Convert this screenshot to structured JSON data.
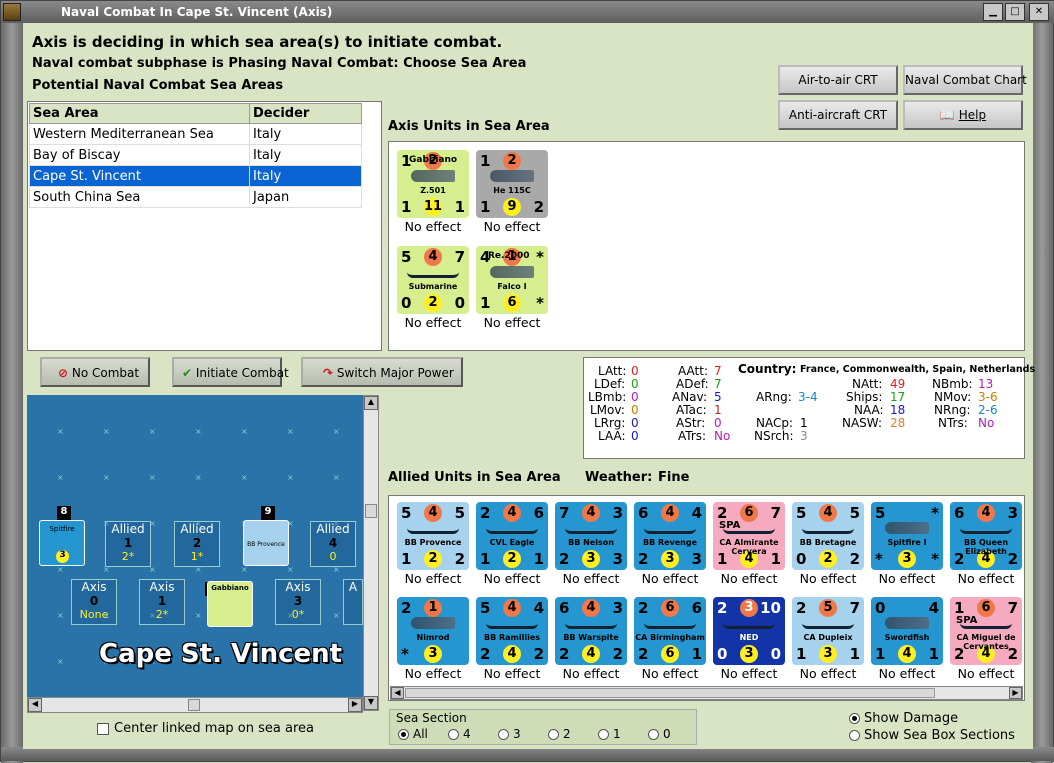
{
  "window": {
    "title": "Naval Combat In Cape St. Vincent (Axis)"
  },
  "header": {
    "line1": "Axis is deciding in which sea area(s) to initiate combat.",
    "line2": "Naval combat subphase is Phasing Naval Combat: Choose Sea Area",
    "line3": "Potential Naval Combat Sea Areas"
  },
  "top_buttons": {
    "air_to_air": "Air-to-air CRT",
    "naval_chart": "Naval Combat Chart",
    "anti_aircraft": "Anti-aircraft CRT",
    "help": "Help"
  },
  "sea_table": {
    "headers": [
      "Sea Area",
      "Decider"
    ],
    "rows": [
      {
        "area": "Western Mediterranean Sea",
        "decider": "Italy"
      },
      {
        "area": "Bay of Biscay",
        "decider": "Italy"
      },
      {
        "area": "Cape St. Vincent",
        "decider": "Italy"
      },
      {
        "area": "South China Sea",
        "decider": "Japan"
      }
    ]
  },
  "axis_units": {
    "title": "Axis Units in Sea Area",
    "units": [
      {
        "tl": "1",
        "tc": "2",
        "tr": "",
        "bl": "1",
        "bc": "11",
        "br": "1",
        "name": "Z.501",
        "top": "Gabbiano",
        "result": "No effect"
      },
      {
        "tl": "1",
        "tc": "2",
        "tr": "",
        "bl": "1",
        "bc": "9",
        "br": "2",
        "name": "He 115C",
        "top": "",
        "result": "No effect"
      },
      {
        "tl": "5",
        "tc": "4",
        "tr": "7",
        "bl": "0",
        "bc": "2",
        "br": "0",
        "name": "Submarine",
        "top": "",
        "result": "No effect"
      },
      {
        "tl": "4",
        "tc": "1",
        "tr": "*",
        "bl": "1",
        "bc": "6",
        "br": "*",
        "name": "Falco I",
        "top": "Re.2000",
        "result": "No effect"
      }
    ]
  },
  "buttons": {
    "no_combat": "No Combat",
    "initiate": "Initiate Combat",
    "switch": "Switch Major Power"
  },
  "stats": {
    "country_label": "Country:",
    "country_value": "France, Commonwealth, Spain, Netherlands",
    "latt_l": "LAtt:",
    "latt": "0",
    "ldef_l": "LDef:",
    "ldef": "0",
    "lbmb_l": "LBmb:",
    "lbmb": "0",
    "lmov_l": "LMov:",
    "lmov": "0",
    "lrg_l": "LRrg:",
    "lrg": "0",
    "laa_l": "LAA:",
    "laa": "0",
    "aatt_l": "AAtt:",
    "aatt": "7",
    "adef_l": "ADef:",
    "adef": "7",
    "anav_l": "ANav:",
    "anav": "5",
    "atac_l": "ATac:",
    "atac": "1",
    "astr_l": "AStr:",
    "astr": "0",
    "atrs_l": "ATrs:",
    "atrs": "No",
    "arng_l": "ARng:",
    "arng": "3-4",
    "nacp_l": "NACp:",
    "nacp": "1",
    "nsrch_l": "NSrch:",
    "nsrch": "3",
    "natt_l": "NAtt:",
    "natt": "49",
    "ships_l": "Ships:",
    "ships": "17",
    "naa_l": "NAA:",
    "naa": "18",
    "nasw_l": "NASW:",
    "nasw": "28",
    "nbmb_l": "NBmb:",
    "nbmb": "13",
    "nmov_l": "NMov:",
    "nmov": "3-6",
    "nrng_l": "NRng:",
    "nrng": "2-6",
    "ntrs_l": "NTrs:",
    "ntrs": "No"
  },
  "allied": {
    "title": "Allied Units in Sea Area",
    "weather_label": "Weather:",
    "weather": "Fine",
    "units": [
      {
        "c": "u-lb",
        "tl": "5",
        "tc": "4",
        "tr": "5",
        "bl": "1",
        "bc": "2",
        "br": "2",
        "name": "BB Provence",
        "result": "No effect"
      },
      {
        "c": "u-db",
        "tl": "2",
        "tc": "4",
        "tr": "6",
        "bl": "1",
        "bc": "2",
        "br": "1",
        "name": "CVL Eagle",
        "result": "No effect"
      },
      {
        "c": "u-db",
        "tl": "7",
        "tc": "4",
        "tr": "3",
        "bl": "2",
        "bc": "3",
        "br": "3",
        "name": "BB Nelson",
        "result": "No effect"
      },
      {
        "c": "u-db",
        "tl": "6",
        "tc": "4",
        "tr": "4",
        "bl": "2",
        "bc": "3",
        "br": "3",
        "name": "BB Revenge",
        "result": "No effect"
      },
      {
        "c": "u-pk",
        "tl": "2",
        "tc": "6",
        "tr": "7",
        "bl": "1",
        "bc": "4",
        "br": "1",
        "name": "CA Almirante Cervera",
        "flag": "SPA",
        "result": "No effect"
      },
      {
        "c": "u-lb",
        "tl": "5",
        "tc": "4",
        "tr": "5",
        "bl": "0",
        "bc": "2",
        "br": "2",
        "name": "BB Bretagne",
        "result": "No effect"
      },
      {
        "c": "u-db",
        "tl": "5",
        "tc": "",
        "tr": "*",
        "bl": "*",
        "bc": "3",
        "br": "*",
        "name": "Spitfire I",
        "result": "No effect"
      },
      {
        "c": "u-db",
        "tl": "6",
        "tc": "4",
        "tr": "3",
        "bl": "2",
        "bc": "4",
        "br": "2",
        "name": "BB Queen Elizabeth",
        "result": "No effect"
      },
      {
        "c": "u-db",
        "tl": "2",
        "tc": "1",
        "tr": "",
        "bl": "*",
        "bc": "3",
        "br": "",
        "name": "Nimrod",
        "result": "No effect"
      },
      {
        "c": "u-db",
        "tl": "5",
        "tc": "4",
        "tr": "4",
        "bl": "2",
        "bc": "4",
        "br": "2",
        "name": "BB Ramillies",
        "result": "No effect"
      },
      {
        "c": "u-db",
        "tl": "6",
        "tc": "4",
        "tr": "3",
        "bl": "2",
        "bc": "4",
        "br": "2",
        "name": "BB Warspite",
        "result": "No effect"
      },
      {
        "c": "u-db",
        "tl": "2",
        "tc": "6",
        "tr": "6",
        "bl": "2",
        "bc": "6",
        "br": "1",
        "name": "CA Birmingham",
        "result": "No effect"
      },
      {
        "c": "u-nv",
        "tl": "2",
        "tc": "3",
        "tr": "10",
        "bl": "0",
        "bc": "3",
        "br": "0",
        "name": "NED",
        "result": "No effect"
      },
      {
        "c": "u-lb",
        "tl": "2",
        "tc": "5",
        "tr": "7",
        "bl": "1",
        "bc": "3",
        "br": "1",
        "name": "CA Dupleix",
        "result": "No effect"
      },
      {
        "c": "u-db",
        "tl": "0",
        "tc": "",
        "tr": "4",
        "bl": "1",
        "bc": "4",
        "br": "1",
        "name": "Swordfish",
        "result": "No effect"
      },
      {
        "c": "u-pk",
        "tl": "1",
        "tc": "6",
        "tr": "7",
        "bl": "2",
        "bc": "4",
        "br": "2",
        "name": "CA Miguel de Cervantes",
        "flag": "SPA",
        "result": "No effect"
      }
    ]
  },
  "map": {
    "label": "Cape St. Vincent",
    "allied_boxes": [
      {
        "t": "Allied",
        "n": "1",
        "v": "2*"
      },
      {
        "t": "Allied",
        "n": "2",
        "v": "1*"
      },
      {
        "t": "Allied",
        "n": "4",
        "v": "0"
      }
    ],
    "axis_boxes": [
      {
        "t": "Axis",
        "n": "0",
        "v": "None"
      },
      {
        "t": "Axis",
        "n": "1",
        "v": "2*"
      },
      {
        "t": "Axis",
        "n": "3",
        "v": "0*"
      },
      {
        "t": "A",
        "n": "",
        "v": ""
      }
    ],
    "stack_labels": [
      "8",
      "9",
      "4"
    ],
    "spitfire": "Spitfire",
    "spitfire_val": "3",
    "provence": "BB Provence",
    "gabbiano": "Gabbiano"
  },
  "bottom": {
    "center_map": "Center linked map on sea area",
    "sea_section": "Sea Section",
    "sections": [
      "All",
      "4",
      "3",
      "2",
      "1",
      "0"
    ],
    "show_damage": "Show Damage",
    "show_boxes": "Show Sea Box Sections"
  }
}
